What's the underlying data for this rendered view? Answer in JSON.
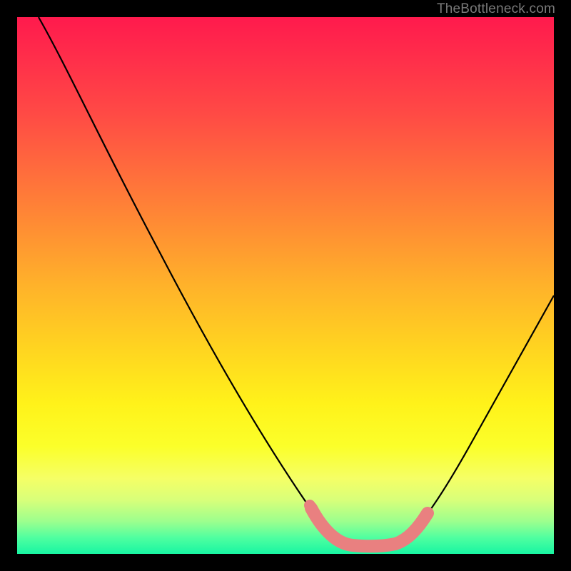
{
  "watermark": "TheBottleneck.com",
  "chart_data": {
    "type": "line",
    "title": "",
    "xlabel": "",
    "ylabel": "",
    "xlim": [
      0,
      100
    ],
    "ylim": [
      0,
      100
    ],
    "series": [
      {
        "name": "bottleneck-curve",
        "color": "#000000",
        "x": [
          4,
          10,
          18,
          26,
          34,
          42,
          50,
          55,
          58,
          61,
          64,
          67,
          70,
          73,
          78,
          84,
          90,
          96,
          100
        ],
        "values": [
          100,
          88,
          74,
          60,
          46,
          32,
          18,
          9,
          4,
          1.5,
          0.8,
          0.8,
          1.5,
          4,
          12,
          24,
          36,
          48,
          56
        ]
      },
      {
        "name": "optimal-band",
        "color": "#e98080",
        "x": [
          55,
          58,
          61,
          64,
          67,
          70,
          73
        ],
        "values": [
          9,
          4,
          1.5,
          0.8,
          0.8,
          1.5,
          4
        ]
      }
    ],
    "gradient_stops": [
      {
        "pos": 0,
        "color": "#ff1a4d"
      },
      {
        "pos": 50,
        "color": "#ffb22a"
      },
      {
        "pos": 80,
        "color": "#fbff2a"
      },
      {
        "pos": 100,
        "color": "#18f5a2"
      }
    ]
  }
}
